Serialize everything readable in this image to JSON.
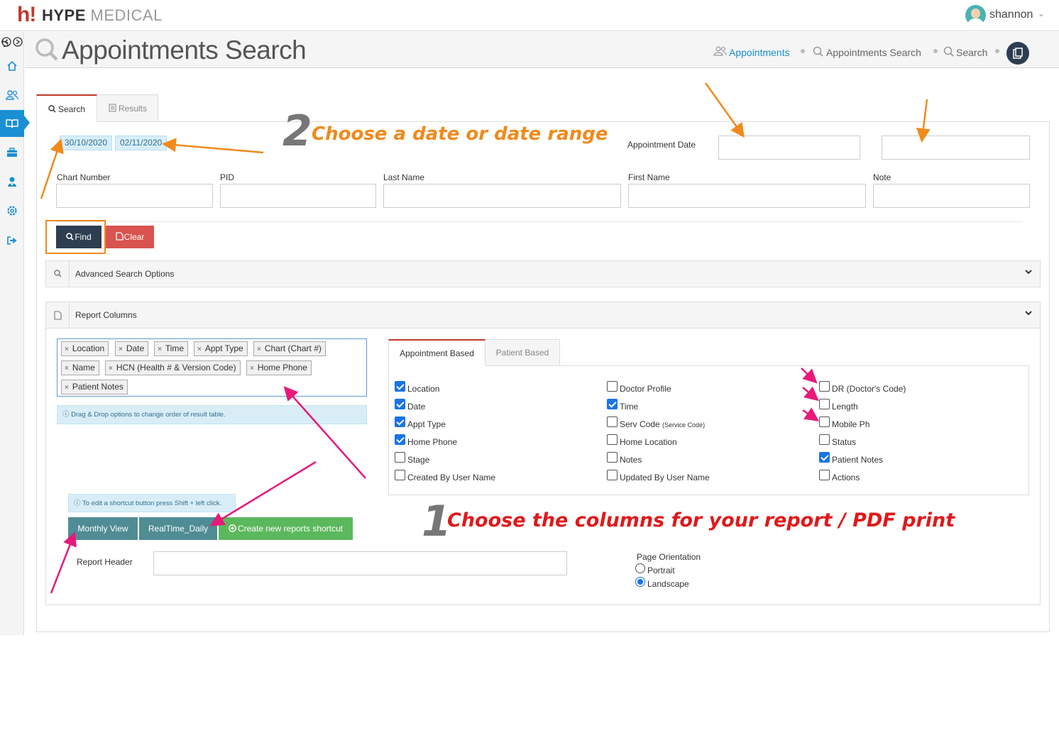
{
  "app": {
    "logo_mark": "h!",
    "brand_part1": "HYPE",
    "brand_part2": "MEDICAL",
    "user": "shannon"
  },
  "sidebar": {
    "items": [
      {
        "icon": "home-icon"
      },
      {
        "icon": "users-icon"
      },
      {
        "icon": "book-icon",
        "active": true
      },
      {
        "icon": "briefcase-icon"
      },
      {
        "icon": "user-doctor-icon"
      },
      {
        "icon": "gear-icon"
      },
      {
        "icon": "logout-icon"
      }
    ]
  },
  "header": {
    "title": "Appointments Search",
    "breadcrumbs": [
      "Appointments",
      "Appointments Search",
      "Search"
    ]
  },
  "tabs": [
    "Search",
    "Results"
  ],
  "search": {
    "date_chips": [
      "30/10/2020",
      "02/11/2020"
    ],
    "appointment_date_label": "Appointment Date",
    "appointment_date_from": "",
    "appointment_date_to": "",
    "fields": [
      {
        "label": "Chart Number",
        "value": ""
      },
      {
        "label": "PID",
        "value": ""
      },
      {
        "label": "Last Name",
        "value": ""
      },
      {
        "label": "First Name",
        "value": ""
      },
      {
        "label": "Note",
        "value": ""
      }
    ],
    "find_label": "Find",
    "clear_label": "Clear",
    "advanced_label": "Advanced Search Options"
  },
  "report": {
    "section_label": "Report Columns",
    "selected_columns": [
      "Location",
      "Date",
      "Time",
      "Appt Type",
      "Chart (Chart #)",
      "Name",
      "HCN (Health # & Version Code)",
      "Home Phone",
      "Patient Notes"
    ],
    "drag_hint": "Drag & Drop options to change order of result table.",
    "shortcut_hint": "To edit a shortcut button press Shift + left click.",
    "shortcuts": [
      "Monthly View",
      "RealTime_Daily"
    ],
    "create_shortcut_label": "Create new reports shortcut",
    "column_tabs": [
      "Appointment Based",
      "Patient Based"
    ],
    "columns": [
      {
        "label": "Location",
        "checked": true
      },
      {
        "label": "Date",
        "checked": true
      },
      {
        "label": "Appt Type",
        "checked": true
      },
      {
        "label": "Home Phone",
        "checked": true
      },
      {
        "label": "Stage",
        "checked": false
      },
      {
        "label": "Created By User Name",
        "checked": false
      },
      {
        "label": "Doctor Profile",
        "checked": false
      },
      {
        "label": "Time",
        "checked": true
      },
      {
        "label": "Serv Code",
        "suffix": "(Service Code)",
        "checked": false
      },
      {
        "label": "Home Location",
        "checked": false
      },
      {
        "label": "Notes",
        "checked": false
      },
      {
        "label": "Updated By User Name",
        "checked": false
      },
      {
        "label": "DR (Doctor's Code)",
        "checked": false
      },
      {
        "label": "Length",
        "checked": false
      },
      {
        "label": "Mobile Ph",
        "checked": false
      },
      {
        "label": "Status",
        "checked": false
      },
      {
        "label": "Patient Notes",
        "checked": true
      },
      {
        "label": "Actions",
        "checked": false
      }
    ],
    "report_header_label": "Report Header",
    "report_header_value": "",
    "page_orientation_label": "Page Orientation",
    "orientations": [
      {
        "label": "Portrait",
        "selected": false
      },
      {
        "label": "Landscape",
        "selected": true
      }
    ]
  },
  "annotations": {
    "step2_num": "2",
    "step2_text": "Choose a date or date range",
    "step1_num": "1",
    "step1_text": "Choose the columns for your report / PDF print"
  },
  "colors": {
    "accent": "#1a8fd4",
    "dark_button": "#2d3e50",
    "clear_button": "#d9534f",
    "shortcut_button": "#4f8c93",
    "create_button": "#5cb85c",
    "annotation_orange": "#f08a1d",
    "annotation_red": "#e0191b",
    "annotation_pink": "#e8197a"
  }
}
